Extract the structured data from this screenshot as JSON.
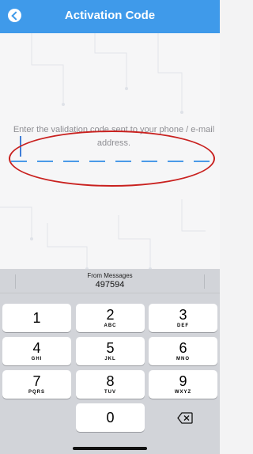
{
  "header": {
    "title": "Activation Code",
    "back_icon": "back-arrow-icon",
    "color": "#3f9aea"
  },
  "main": {
    "instruction": "Enter the validation code sent to your phone / e-mail address.",
    "code_value": ""
  },
  "keyboard": {
    "suggestion_source": "From Messages",
    "suggestion_code": "497594",
    "keys": [
      {
        "num": "1",
        "letters": ""
      },
      {
        "num": "2",
        "letters": "ABC"
      },
      {
        "num": "3",
        "letters": "DEF"
      },
      {
        "num": "4",
        "letters": "GHI"
      },
      {
        "num": "5",
        "letters": "JKL"
      },
      {
        "num": "6",
        "letters": "MNO"
      },
      {
        "num": "7",
        "letters": "PQRS"
      },
      {
        "num": "8",
        "letters": "TUV"
      },
      {
        "num": "9",
        "letters": "WXYZ"
      },
      {
        "num": "0",
        "letters": ""
      }
    ],
    "delete_icon": "backspace-icon"
  }
}
